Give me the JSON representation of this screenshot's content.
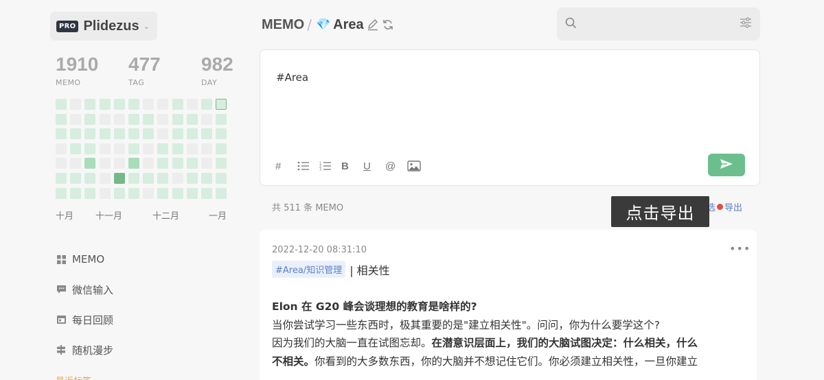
{
  "user": {
    "badge": "PRO",
    "name": "Plidezus"
  },
  "stats": [
    {
      "num": "1910",
      "label": "MEMO"
    },
    {
      "num": "477",
      "label": "TAG"
    },
    {
      "num": "982",
      "label": "DAY"
    }
  ],
  "heatmap": {
    "levels": [
      [
        1,
        0,
        1,
        1,
        1,
        1,
        0,
        0,
        1,
        0,
        1,
        1
      ],
      [
        1,
        0,
        1,
        0,
        0,
        1,
        1,
        0,
        1,
        1,
        0,
        1
      ],
      [
        1,
        1,
        1,
        1,
        1,
        1,
        1,
        0,
        1,
        1,
        1,
        1
      ],
      [
        0,
        1,
        1,
        0,
        0,
        1,
        0,
        1,
        1,
        0,
        0,
        1
      ],
      [
        0,
        0,
        2,
        0,
        0,
        2,
        0,
        1,
        1,
        1,
        0,
        1
      ],
      [
        1,
        1,
        1,
        0,
        3,
        1,
        1,
        1,
        0,
        1,
        1,
        1
      ],
      [
        1,
        1,
        1,
        0,
        1,
        1,
        0,
        1,
        1,
        1,
        1,
        1
      ]
    ],
    "colors": {
      "empty": "#ededed",
      "low": "#d6eddf",
      "mid": "#a9dcb9",
      "high": "#74b98a"
    },
    "months": [
      "十月",
      "十一月",
      "十二月",
      "一月"
    ]
  },
  "nav": [
    {
      "icon": "grid-icon",
      "label": "MEMO"
    },
    {
      "icon": "chat-icon",
      "label": "微信输入"
    },
    {
      "icon": "calendar-icon",
      "label": "每日回顾"
    },
    {
      "icon": "signpost-icon",
      "label": "随机漫步"
    }
  ],
  "nav_cut": "最近标签",
  "header": {
    "section": "MEMO",
    "separator": "/",
    "gem": "💎",
    "tag": "Area"
  },
  "search": {
    "placeholder": "",
    "value": ""
  },
  "editor": {
    "text": "#Area",
    "tools": [
      "#",
      "",
      "",
      "B",
      "U",
      "@",
      ""
    ]
  },
  "list": {
    "count": "共 511 条 MEMO",
    "filter": "筛选",
    "export": "导出",
    "tooltip": "点击导出"
  },
  "memo": {
    "time": "2022-12-20 08:31:10",
    "more": "•••",
    "tag": "#Area/知识管理",
    "tagline_rest": "| 相关性",
    "lines": [
      [
        {
          "t": "Elon 在 G20 峰会谈理想的教育是啥样的?",
          "b": true
        }
      ],
      [
        {
          "t": "当你尝试学习一些东西时，极其重要的是\"建立相关性\"。问问，你为什么要学这个?",
          "b": false
        }
      ],
      [
        {
          "t": "因为我们的大脑一直在试图忘却。",
          "b": false
        },
        {
          "t": "在潜意识层面上，我们的大脑试图决定：什么相关，什么",
          "b": true
        }
      ],
      [
        {
          "t": "不相关。",
          "b": true
        },
        {
          "t": "你看到的大多数东西，你的大脑并不想记住它们。你必须建立相关性，一旦你建立",
          "b": false
        }
      ]
    ]
  },
  "colors": {
    "accent": "#6abf8d",
    "link": "#5b7fc7",
    "dot": "#e64a3c",
    "badge": "#2f3542"
  }
}
